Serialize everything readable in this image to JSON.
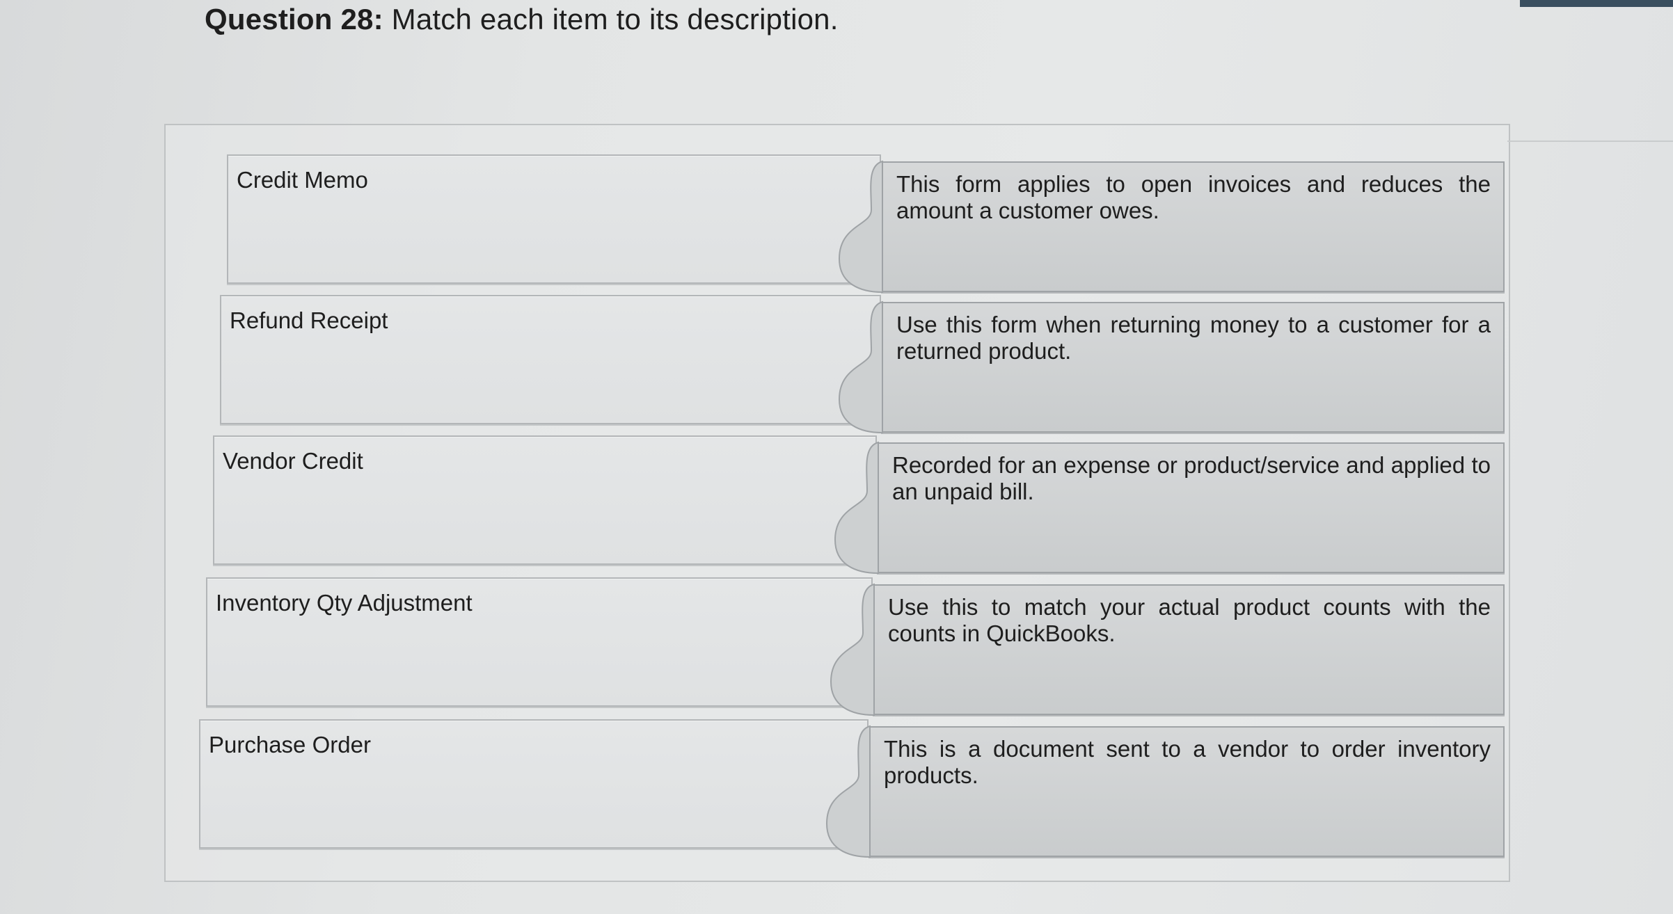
{
  "question": {
    "label": "Question 28:",
    "prompt": "Match each item to its description."
  },
  "items": [
    {
      "label": "Credit Memo"
    },
    {
      "label": "Refund Receipt"
    },
    {
      "label": "Vendor Credit"
    },
    {
      "label": "Inventory Qty Adjustment"
    },
    {
      "label": "Purchase Order"
    }
  ],
  "descriptions": [
    {
      "text": "This form applies to open invoices and reduces the amount a customer owes."
    },
    {
      "text": "Use this form when returning money to a customer for a returned product."
    },
    {
      "text": "Recorded for an expense or product/service and applied to an unpaid bill."
    },
    {
      "text": "Use this to match your actual product counts with the counts in QuickBooks."
    },
    {
      "text": "This is a document sent to a vendor to order inventory products."
    }
  ],
  "colors": {
    "background": "#e3e5e5",
    "item_fill": "#e1e3e4",
    "description_fill": "#cfd2d3",
    "border": "#9fa3a6",
    "text": "#1e1e1e"
  }
}
